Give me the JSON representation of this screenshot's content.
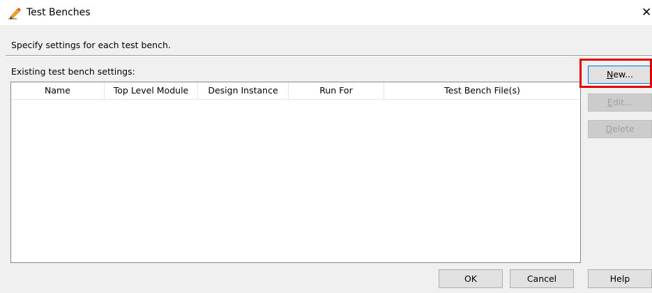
{
  "window": {
    "title": "Test Benches",
    "close_glyph": "✕"
  },
  "description": "Specify settings for each test bench.",
  "existing_label": "Existing test bench settings:",
  "table": {
    "columns": [
      "Name",
      "Top Level Module",
      "Design Instance",
      "Run For",
      "Test Bench File(s)"
    ],
    "rows": []
  },
  "side_buttons": {
    "new": {
      "mnemonic": "N",
      "rest": "ew..."
    },
    "edit": {
      "mnemonic": "E",
      "rest": "dit..."
    },
    "delete": {
      "mnemonic": "D",
      "rest": "elete"
    }
  },
  "footer_buttons": {
    "ok": "OK",
    "cancel": "Cancel",
    "help": "Help"
  },
  "colors": {
    "highlight": "#e00000",
    "focus_border": "#0078d7"
  }
}
